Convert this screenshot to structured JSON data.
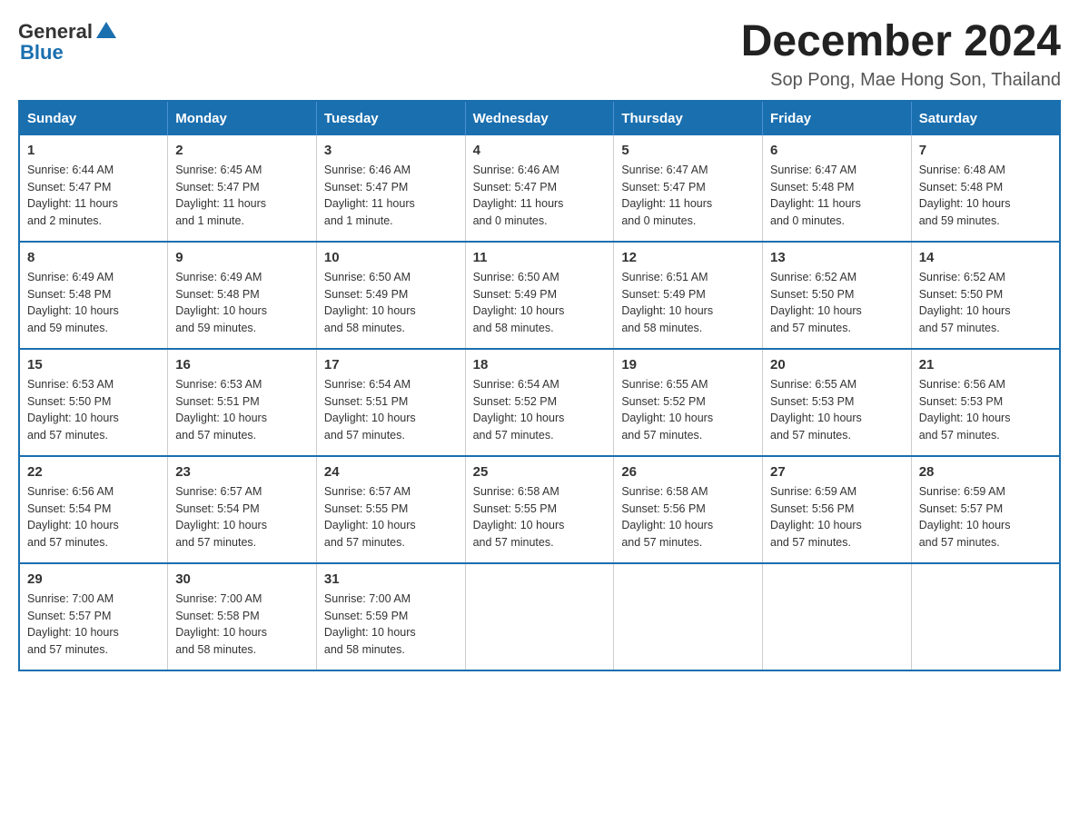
{
  "header": {
    "logo_general": "General",
    "logo_blue": "Blue",
    "month_title": "December 2024",
    "subtitle": "Sop Pong, Mae Hong Son, Thailand"
  },
  "days_of_week": [
    "Sunday",
    "Monday",
    "Tuesday",
    "Wednesday",
    "Thursday",
    "Friday",
    "Saturday"
  ],
  "weeks": [
    [
      {
        "day": "1",
        "info": "Sunrise: 6:44 AM\nSunset: 5:47 PM\nDaylight: 11 hours\nand 2 minutes."
      },
      {
        "day": "2",
        "info": "Sunrise: 6:45 AM\nSunset: 5:47 PM\nDaylight: 11 hours\nand 1 minute."
      },
      {
        "day": "3",
        "info": "Sunrise: 6:46 AM\nSunset: 5:47 PM\nDaylight: 11 hours\nand 1 minute."
      },
      {
        "day": "4",
        "info": "Sunrise: 6:46 AM\nSunset: 5:47 PM\nDaylight: 11 hours\nand 0 minutes."
      },
      {
        "day": "5",
        "info": "Sunrise: 6:47 AM\nSunset: 5:47 PM\nDaylight: 11 hours\nand 0 minutes."
      },
      {
        "day": "6",
        "info": "Sunrise: 6:47 AM\nSunset: 5:48 PM\nDaylight: 11 hours\nand 0 minutes."
      },
      {
        "day": "7",
        "info": "Sunrise: 6:48 AM\nSunset: 5:48 PM\nDaylight: 10 hours\nand 59 minutes."
      }
    ],
    [
      {
        "day": "8",
        "info": "Sunrise: 6:49 AM\nSunset: 5:48 PM\nDaylight: 10 hours\nand 59 minutes."
      },
      {
        "day": "9",
        "info": "Sunrise: 6:49 AM\nSunset: 5:48 PM\nDaylight: 10 hours\nand 59 minutes."
      },
      {
        "day": "10",
        "info": "Sunrise: 6:50 AM\nSunset: 5:49 PM\nDaylight: 10 hours\nand 58 minutes."
      },
      {
        "day": "11",
        "info": "Sunrise: 6:50 AM\nSunset: 5:49 PM\nDaylight: 10 hours\nand 58 minutes."
      },
      {
        "day": "12",
        "info": "Sunrise: 6:51 AM\nSunset: 5:49 PM\nDaylight: 10 hours\nand 58 minutes."
      },
      {
        "day": "13",
        "info": "Sunrise: 6:52 AM\nSunset: 5:50 PM\nDaylight: 10 hours\nand 57 minutes."
      },
      {
        "day": "14",
        "info": "Sunrise: 6:52 AM\nSunset: 5:50 PM\nDaylight: 10 hours\nand 57 minutes."
      }
    ],
    [
      {
        "day": "15",
        "info": "Sunrise: 6:53 AM\nSunset: 5:50 PM\nDaylight: 10 hours\nand 57 minutes."
      },
      {
        "day": "16",
        "info": "Sunrise: 6:53 AM\nSunset: 5:51 PM\nDaylight: 10 hours\nand 57 minutes."
      },
      {
        "day": "17",
        "info": "Sunrise: 6:54 AM\nSunset: 5:51 PM\nDaylight: 10 hours\nand 57 minutes."
      },
      {
        "day": "18",
        "info": "Sunrise: 6:54 AM\nSunset: 5:52 PM\nDaylight: 10 hours\nand 57 minutes."
      },
      {
        "day": "19",
        "info": "Sunrise: 6:55 AM\nSunset: 5:52 PM\nDaylight: 10 hours\nand 57 minutes."
      },
      {
        "day": "20",
        "info": "Sunrise: 6:55 AM\nSunset: 5:53 PM\nDaylight: 10 hours\nand 57 minutes."
      },
      {
        "day": "21",
        "info": "Sunrise: 6:56 AM\nSunset: 5:53 PM\nDaylight: 10 hours\nand 57 minutes."
      }
    ],
    [
      {
        "day": "22",
        "info": "Sunrise: 6:56 AM\nSunset: 5:54 PM\nDaylight: 10 hours\nand 57 minutes."
      },
      {
        "day": "23",
        "info": "Sunrise: 6:57 AM\nSunset: 5:54 PM\nDaylight: 10 hours\nand 57 minutes."
      },
      {
        "day": "24",
        "info": "Sunrise: 6:57 AM\nSunset: 5:55 PM\nDaylight: 10 hours\nand 57 minutes."
      },
      {
        "day": "25",
        "info": "Sunrise: 6:58 AM\nSunset: 5:55 PM\nDaylight: 10 hours\nand 57 minutes."
      },
      {
        "day": "26",
        "info": "Sunrise: 6:58 AM\nSunset: 5:56 PM\nDaylight: 10 hours\nand 57 minutes."
      },
      {
        "day": "27",
        "info": "Sunrise: 6:59 AM\nSunset: 5:56 PM\nDaylight: 10 hours\nand 57 minutes."
      },
      {
        "day": "28",
        "info": "Sunrise: 6:59 AM\nSunset: 5:57 PM\nDaylight: 10 hours\nand 57 minutes."
      }
    ],
    [
      {
        "day": "29",
        "info": "Sunrise: 7:00 AM\nSunset: 5:57 PM\nDaylight: 10 hours\nand 57 minutes."
      },
      {
        "day": "30",
        "info": "Sunrise: 7:00 AM\nSunset: 5:58 PM\nDaylight: 10 hours\nand 58 minutes."
      },
      {
        "day": "31",
        "info": "Sunrise: 7:00 AM\nSunset: 5:59 PM\nDaylight: 10 hours\nand 58 minutes."
      },
      {
        "day": "",
        "info": ""
      },
      {
        "day": "",
        "info": ""
      },
      {
        "day": "",
        "info": ""
      },
      {
        "day": "",
        "info": ""
      }
    ]
  ]
}
